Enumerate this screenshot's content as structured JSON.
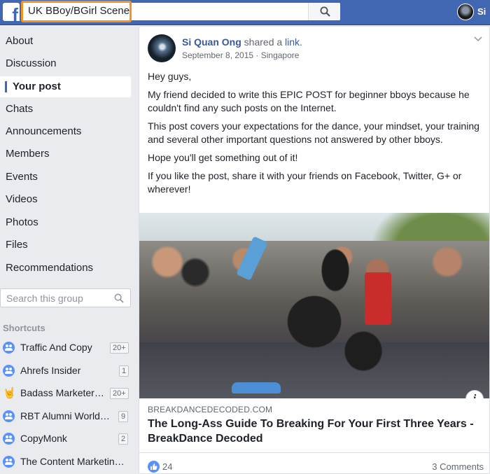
{
  "topbar": {
    "logo_letter": "f",
    "search_value": "UK BBoy/BGirl Scene",
    "profile_name": "Si"
  },
  "sidebar": {
    "items": [
      {
        "label": "About"
      },
      {
        "label": "Discussion"
      },
      {
        "label": "Your post",
        "active": true
      },
      {
        "label": "Chats"
      },
      {
        "label": "Announcements"
      },
      {
        "label": "Members"
      },
      {
        "label": "Events"
      },
      {
        "label": "Videos"
      },
      {
        "label": "Photos"
      },
      {
        "label": "Files"
      },
      {
        "label": "Recommendations"
      }
    ],
    "group_search_placeholder": "Search this group",
    "shortcuts_title": "Shortcuts",
    "shortcuts": [
      {
        "label": "Traffic And Copy",
        "badge": "20+",
        "icon": "group-icon"
      },
      {
        "label": "Ahrefs Insider",
        "badge": "1",
        "icon": "group-icon"
      },
      {
        "label": "Badass Marketers ...",
        "badge": "20+",
        "icon": "rock-hand-icon"
      },
      {
        "label": "RBT Alumni Worldwi...",
        "badge": "9",
        "icon": "group-icon"
      },
      {
        "label": "CopyMonk",
        "badge": "2",
        "icon": "group-icon"
      },
      {
        "label": "The Content Marketing...",
        "badge": "",
        "icon": "group-icon"
      }
    ]
  },
  "post": {
    "author": "Si Quan Ong",
    "action": "shared a",
    "action_link": "link.",
    "date": "September 8, 2015 · Singapore",
    "paragraphs": [
      "Hey guys,",
      "My friend decided to write this EPIC POST for beginner bboys because he couldn't find any such posts on the Internet.",
      "This post covers your expectations for the dance, your mindset, your training and several other important questions not answered by other bboys.",
      "Hope you'll get something out of it!",
      "If you like the post, share it with your friends on Facebook, Twitter, G+ or wherever!"
    ],
    "link": {
      "domain": "BREAKDANCEDECODED.COM",
      "title": "The Long-Ass Guide To Breaking For Your First Three Years - BreakDance Decoded",
      "info_glyph": "i"
    },
    "likes": "24",
    "comments": "3 Comments"
  },
  "colors": {
    "brand": "#4267b2",
    "highlight": "#f7931e",
    "link": "#385898"
  }
}
